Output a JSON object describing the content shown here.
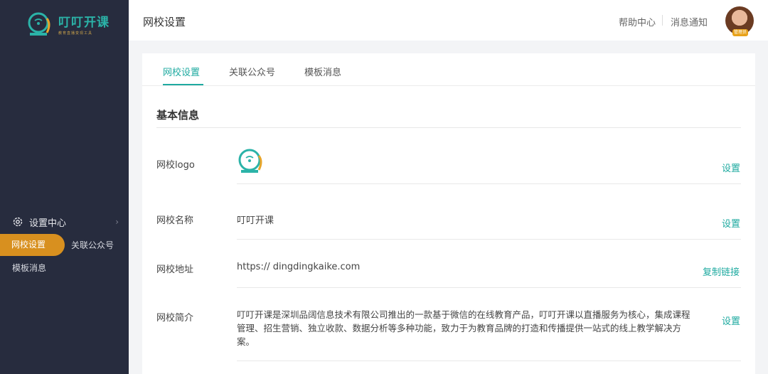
{
  "app": {
    "brand_name": "叮叮开课",
    "brand_tagline": "教育直播变现工具"
  },
  "sidebar": {
    "group_label": "设置中心",
    "items": [
      {
        "label": "网校设置",
        "active": true
      },
      {
        "label": "关联公众号",
        "active": false
      },
      {
        "label": "模板消息",
        "active": false
      }
    ]
  },
  "topbar": {
    "title": "网校设置",
    "help": "帮助中心",
    "notifications": "消息通知",
    "avatar_badge": "管理员"
  },
  "tabs": [
    {
      "label": "网校设置",
      "active": true
    },
    {
      "label": "关联公众号",
      "active": false
    },
    {
      "label": "模板消息",
      "active": false
    }
  ],
  "basic_info": {
    "section_title": "基本信息",
    "logo": {
      "label": "网校logo",
      "action": "设置"
    },
    "name": {
      "label": "网校名称",
      "value": "叮叮开课",
      "action": "设置"
    },
    "address": {
      "label": "网校地址",
      "value": "https:// dingdingkaike.com",
      "action": "复制链接"
    },
    "intro": {
      "label": "网校简介",
      "value": "叮叮开课是深圳品阔信息技术有限公司推出的一款基于微信的在线教育产品，叮叮开课以直播服务为核心，集成课程管理、招生营销、独立收款、数据分析等多种功能，致力于为教育品牌的打造和传播提供一站式的线上教学解决方案。",
      "action": "设置"
    }
  },
  "colors": {
    "sidebar_bg": "#272c3e",
    "accent_teal": "#1eaaa0",
    "accent_orange": "#d8901f"
  }
}
